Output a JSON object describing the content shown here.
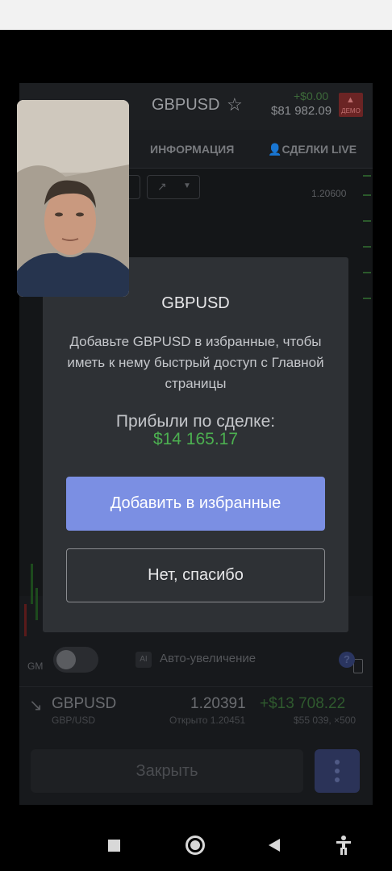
{
  "app": {
    "pair": "GBPUSD",
    "balance_change": "+$0.00",
    "balance": "$81 982.09",
    "demo_badge": "ДЕМО",
    "tabs": [
      {
        "label": "ИНФОРМАЦИЯ"
      },
      {
        "label": "СДЕЛКИ LIVE"
      }
    ],
    "chart": {
      "price_level": "1.20600",
      "axis_label": "GM"
    },
    "auto_zoom": {
      "ai_label": "AI",
      "label": "Авто-увеличение",
      "enabled": false
    },
    "position": {
      "pair": "GBPUSD",
      "sub": "GBP/USD",
      "price": "1.20391",
      "profit": "+$13 708.22",
      "opened": "Открыто 1.20451",
      "amount": "$55 039, ×500"
    },
    "close_button": "Закрыть"
  },
  "modal": {
    "title": "GBPUSD",
    "message": "Добавьте GBPUSD в избранные, чтобы иметь к нему быстрый доступ с Главной страницы",
    "profit_label": "Прибыли по сделке:",
    "profit_value": "$14 165.17",
    "add_button": "Добавить в избранные",
    "decline_button": "Нет, спасибо"
  },
  "colors": {
    "accent": "#7b8fe3",
    "profit": "#4caf50"
  },
  "icons": [
    "star-icon",
    "user-icon",
    "ai-icon",
    "help-icon",
    "arrow-down-right-icon",
    "more-icon",
    "recents-icon",
    "home-icon",
    "back-icon",
    "accessibility-icon"
  ]
}
